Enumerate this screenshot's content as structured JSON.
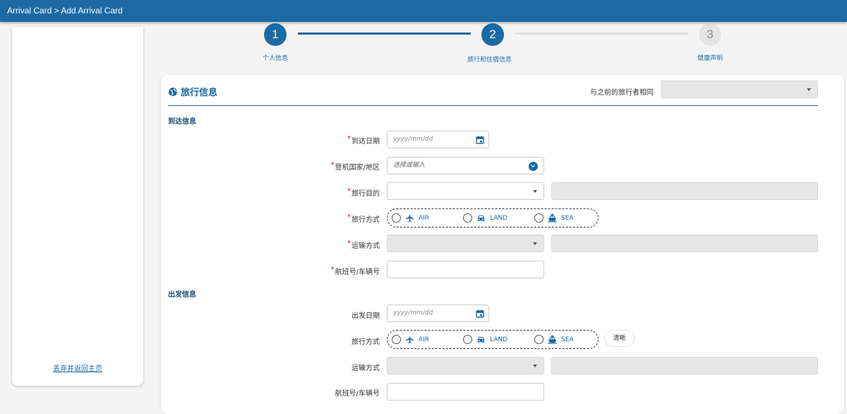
{
  "header": {
    "breadcrumb": "Arrival Card > Add Arrival Card"
  },
  "sidebar": {
    "back_link": "丢弃并返回主页"
  },
  "steps": [
    {
      "number": "1",
      "label": "个人信息",
      "state": "done"
    },
    {
      "number": "2",
      "label": "旅行和住宿信息",
      "state": "current"
    },
    {
      "number": "3",
      "label": "健康声明",
      "state": "pending"
    }
  ],
  "section": {
    "title": "旅行信息",
    "same_as_prev_label": "与之前的旅行者相同"
  },
  "arrival": {
    "heading": "到达信息",
    "date_label": "到达日期",
    "date_placeholder": "yyyy/mm/dd",
    "country_label": "登机国家/地区",
    "country_placeholder": "选择或输入",
    "purpose_label": "旅行目的",
    "mode_label": "旅行方式",
    "transport_label": "运输方式",
    "flight_label": "航班号/车辆号"
  },
  "departure": {
    "heading": "出发信息",
    "date_label": "出发日期",
    "date_placeholder": "yyyy/mm/dd",
    "mode_label": "旅行方式",
    "clear_label": "清晰",
    "transport_label": "运输方式",
    "flight_label": "航班号/车辆号"
  },
  "travel_modes": {
    "air": "AIR",
    "land": "LAND",
    "sea": "SEA"
  },
  "colors": {
    "primary": "#1b6aa5",
    "required": "#d0021b",
    "disabled": "#e6e6e6"
  }
}
